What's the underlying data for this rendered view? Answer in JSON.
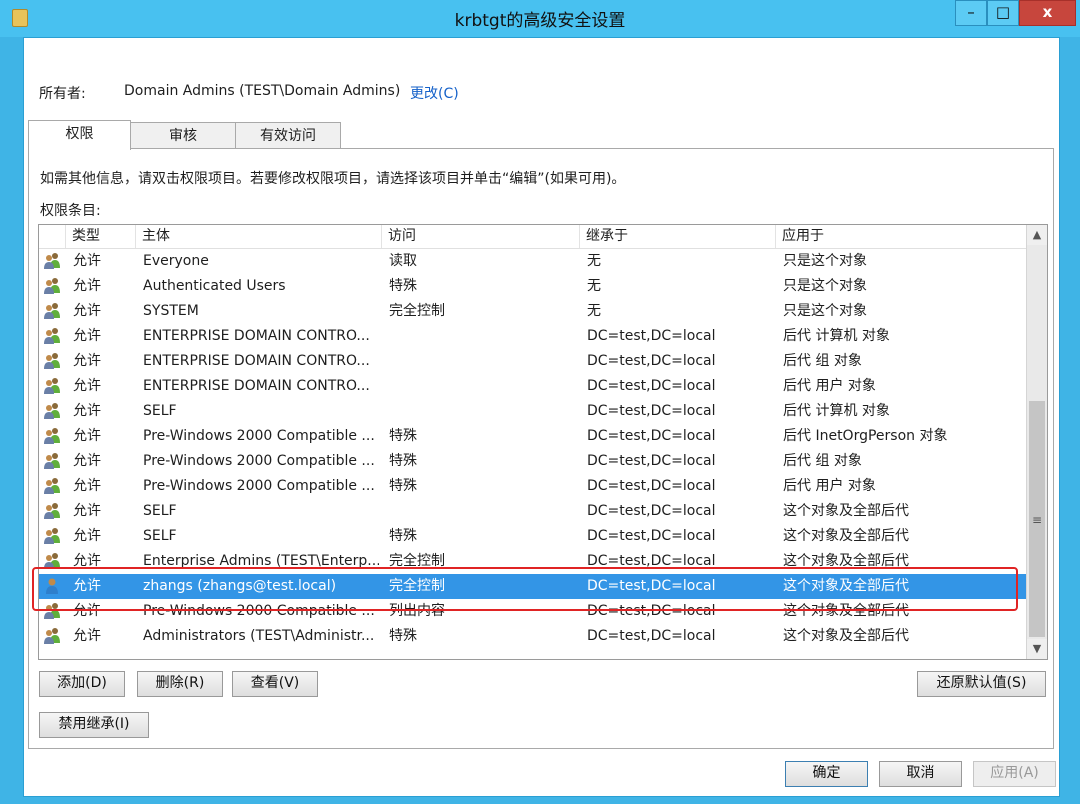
{
  "window": {
    "title": "krbtgt的高级安全设置",
    "controls": {
      "minimize": "–",
      "maximize": "□",
      "close": "x"
    }
  },
  "owner": {
    "label": "所有者:",
    "value": "Domain Admins (TEST\\Domain Admins)",
    "change_link": "更改(C)"
  },
  "tabs": [
    {
      "label": "权限",
      "active": true
    },
    {
      "label": "审核",
      "active": false
    },
    {
      "label": "有效访问",
      "active": false
    }
  ],
  "info_text": "如需其他信息，请双击权限项目。若要修改权限项目，请选择该项目并单击“编辑”(如果可用)。",
  "entries_label": "权限条目:",
  "columns": [
    "类型",
    "主体",
    "访问",
    "继承于",
    "应用于"
  ],
  "entries": [
    {
      "type": "允许",
      "principal": "Everyone",
      "access": "读取",
      "inherited": "无",
      "applies": "只是这个对象"
    },
    {
      "type": "允许",
      "principal": "Authenticated Users",
      "access": "特殊",
      "inherited": "无",
      "applies": "只是这个对象"
    },
    {
      "type": "允许",
      "principal": "SYSTEM",
      "access": "完全控制",
      "inherited": "无",
      "applies": "只是这个对象"
    },
    {
      "type": "允许",
      "principal": "ENTERPRISE DOMAIN CONTRO...",
      "access": "",
      "inherited": "DC=test,DC=local",
      "applies": "后代 计算机 对象"
    },
    {
      "type": "允许",
      "principal": "ENTERPRISE DOMAIN CONTRO...",
      "access": "",
      "inherited": "DC=test,DC=local",
      "applies": "后代 组 对象"
    },
    {
      "type": "允许",
      "principal": "ENTERPRISE DOMAIN CONTRO...",
      "access": "",
      "inherited": "DC=test,DC=local",
      "applies": "后代 用户 对象"
    },
    {
      "type": "允许",
      "principal": "SELF",
      "access": "",
      "inherited": "DC=test,DC=local",
      "applies": "后代 计算机 对象"
    },
    {
      "type": "允许",
      "principal": "Pre-Windows 2000 Compatible ...",
      "access": "特殊",
      "inherited": "DC=test,DC=local",
      "applies": "后代 InetOrgPerson 对象"
    },
    {
      "type": "允许",
      "principal": "Pre-Windows 2000 Compatible ...",
      "access": "特殊",
      "inherited": "DC=test,DC=local",
      "applies": "后代 组 对象"
    },
    {
      "type": "允许",
      "principal": "Pre-Windows 2000 Compatible ...",
      "access": "特殊",
      "inherited": "DC=test,DC=local",
      "applies": "后代 用户 对象"
    },
    {
      "type": "允许",
      "principal": "SELF",
      "access": "",
      "inherited": "DC=test,DC=local",
      "applies": "这个对象及全部后代"
    },
    {
      "type": "允许",
      "principal": "SELF",
      "access": "特殊",
      "inherited": "DC=test,DC=local",
      "applies": "这个对象及全部后代"
    },
    {
      "type": "允许",
      "principal": "Enterprise Admins (TEST\\Enterp...",
      "access": "完全控制",
      "inherited": "DC=test,DC=local",
      "applies": "这个对象及全部后代"
    },
    {
      "type": "允许",
      "principal": "zhangs (zhangs@test.local)",
      "access": "完全控制",
      "inherited": "DC=test,DC=local",
      "applies": "这个对象及全部后代",
      "selected": true,
      "single_user": true
    },
    {
      "type": "允许",
      "principal": "Pre-Windows 2000 Compatible ...",
      "access": "列出内容",
      "inherited": "DC=test,DC=local",
      "applies": "这个对象及全部后代"
    },
    {
      "type": "允许",
      "principal": "Administrators (TEST\\Administr...",
      "access": "特殊",
      "inherited": "DC=test,DC=local",
      "applies": "这个对象及全部后代"
    }
  ],
  "buttons": {
    "add": "添加(D)",
    "remove": "删除(R)",
    "view": "查看(V)",
    "restore_defaults": "还原默认值(S)",
    "disable_inheritance": "禁用继承(I)",
    "ok": "确定",
    "cancel": "取消",
    "apply": "应用(A)"
  },
  "scroll": {
    "up_arrow": "▲",
    "down_arrow": "▼",
    "grip": "≡"
  }
}
